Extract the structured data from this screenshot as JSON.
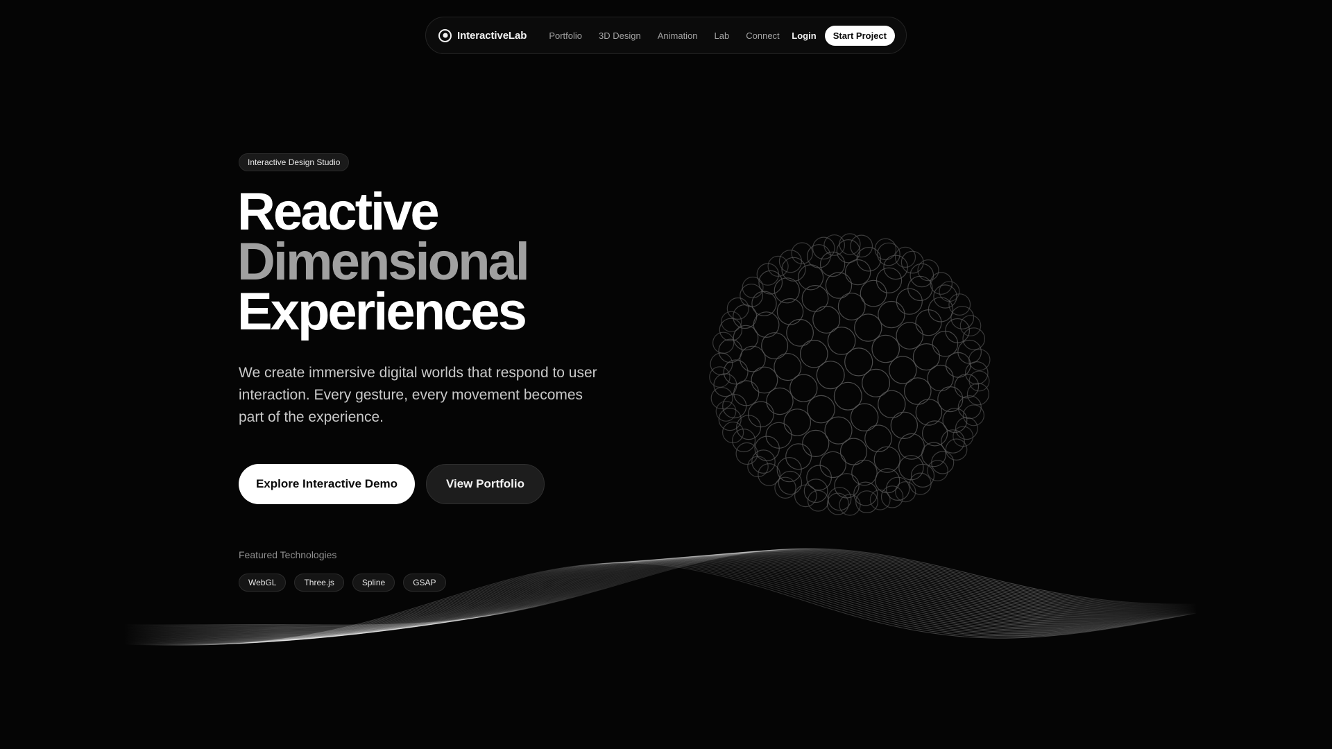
{
  "nav": {
    "brand": "InteractiveLab",
    "links": [
      "Portfolio",
      "3D Design",
      "Animation",
      "Lab",
      "Connect"
    ],
    "login": "Login",
    "cta": "Start Project"
  },
  "hero": {
    "badge": "Interactive Design Studio",
    "title_line1": "Reactive",
    "title_line2": "Dimensional",
    "title_line3": "Experiences",
    "subtitle": "We create immersive digital worlds that respond to user interaction. Every gesture, every movement becomes part of the experience.",
    "primary_button": "Explore Interactive Demo",
    "secondary_button": "View Portfolio",
    "featured_label": "Featured Technologies",
    "technologies": [
      "WebGL",
      "Three.js",
      "Spline",
      "GSAP"
    ]
  },
  "colors": {
    "background": "#050505",
    "accent": "#ffffff",
    "muted_heading": "#a0a0a0"
  },
  "icons": {
    "brand": "circle-dot-icon"
  }
}
